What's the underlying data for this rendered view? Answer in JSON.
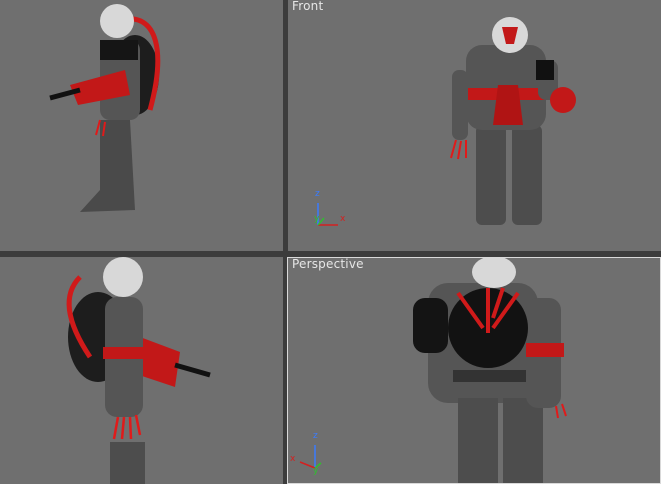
{
  "viewports": {
    "top_left": {
      "label": ""
    },
    "front": {
      "label": "Front",
      "axes": {
        "z": "z",
        "y": "y",
        "x": "x"
      }
    },
    "bottom_left": {
      "label": ""
    },
    "perspective": {
      "label": "Perspective",
      "axes": {
        "z": "z",
        "y": "y",
        "x": "x"
      }
    }
  },
  "colors": {
    "viewport_bg": "#6f6f6f",
    "active_border": "#d9d9d9",
    "character_body": "#4a4a4a",
    "character_red": "#d01a1a",
    "helmet": "#d8d8d8",
    "axis_x": "#d42020",
    "axis_y": "#2fbf2f",
    "axis_z": "#3a7cff"
  }
}
